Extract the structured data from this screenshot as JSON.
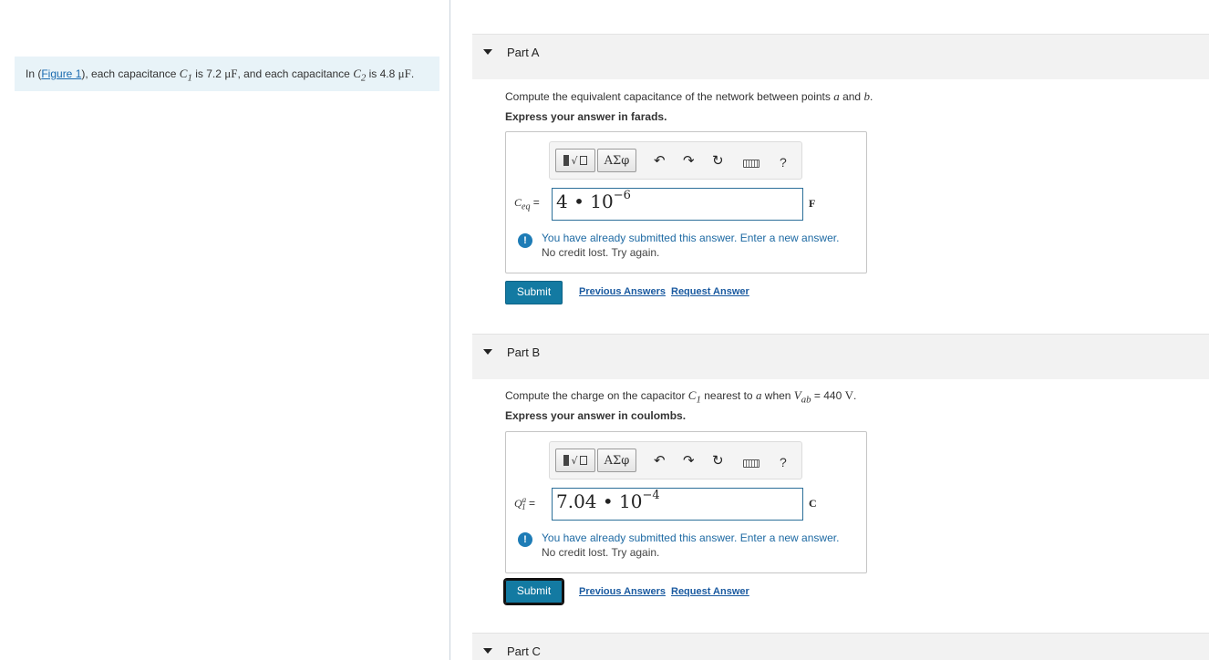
{
  "intro": {
    "text_before": "In (",
    "figure_link": "Figure 1",
    "text_mid1": "), each capacitance ",
    "c1_symbol": "C",
    "c1_sub": "1",
    "text_mid2": " is 7.2 ",
    "unit_uF": "μF",
    "text_mid3": ", and each capacitance ",
    "c2_symbol": "C",
    "c2_sub": "2",
    "text_mid4": " is 4.8 ",
    "unit_uF2": "μF",
    "text_end": "."
  },
  "toolbar": {
    "greek_label": "ΑΣφ",
    "undo_glyph": "↶",
    "redo_glyph": "↷",
    "reset_glyph": "↻",
    "help_label": "?"
  },
  "parts": [
    {
      "title": "Part A",
      "prompt_before": "Compute the equivalent capacitance of the network between points ",
      "point_a": "a",
      "prompt_and": " and ",
      "point_b": "b",
      "prompt_end": ".",
      "express": "Express your answer in farads.",
      "eq_symbol": "C",
      "eq_sub": "eq",
      "eq_sign": " =",
      "answer_base": "4 • 10",
      "answer_exp": "−6",
      "unit": "F",
      "feedback_line1": "You have already submitted this answer. Enter a new answer.",
      "feedback_line2": "No credit lost. Try again.",
      "submit": "Submit",
      "previous_answers": "Previous Answers",
      "request_answer": "Request Answer"
    },
    {
      "title": "Part B",
      "prompt_before": "Compute the charge on the capacitor ",
      "c_symbol": "C",
      "c_sub": "1",
      "prompt_mid": " nearest to ",
      "point_a": "a",
      "prompt_when": " when ",
      "v_symbol": "V",
      "v_sub": "ab",
      "prompt_value": " = 440 ",
      "v_unit": "V",
      "prompt_end": ".",
      "express": "Express your answer in coulombs.",
      "eq_symbol": "Q",
      "eq_sup": "a",
      "eq_sub": "1",
      "eq_sign": " =",
      "answer_base": "7.04 • 10",
      "answer_exp": "−4",
      "unit": "C",
      "feedback_line1": "You have already submitted this answer. Enter a new answer.",
      "feedback_line2": "No credit lost. Try again.",
      "submit": "Submit",
      "previous_answers": "Previous Answers",
      "request_answer": "Request Answer"
    },
    {
      "title": "Part C"
    }
  ]
}
